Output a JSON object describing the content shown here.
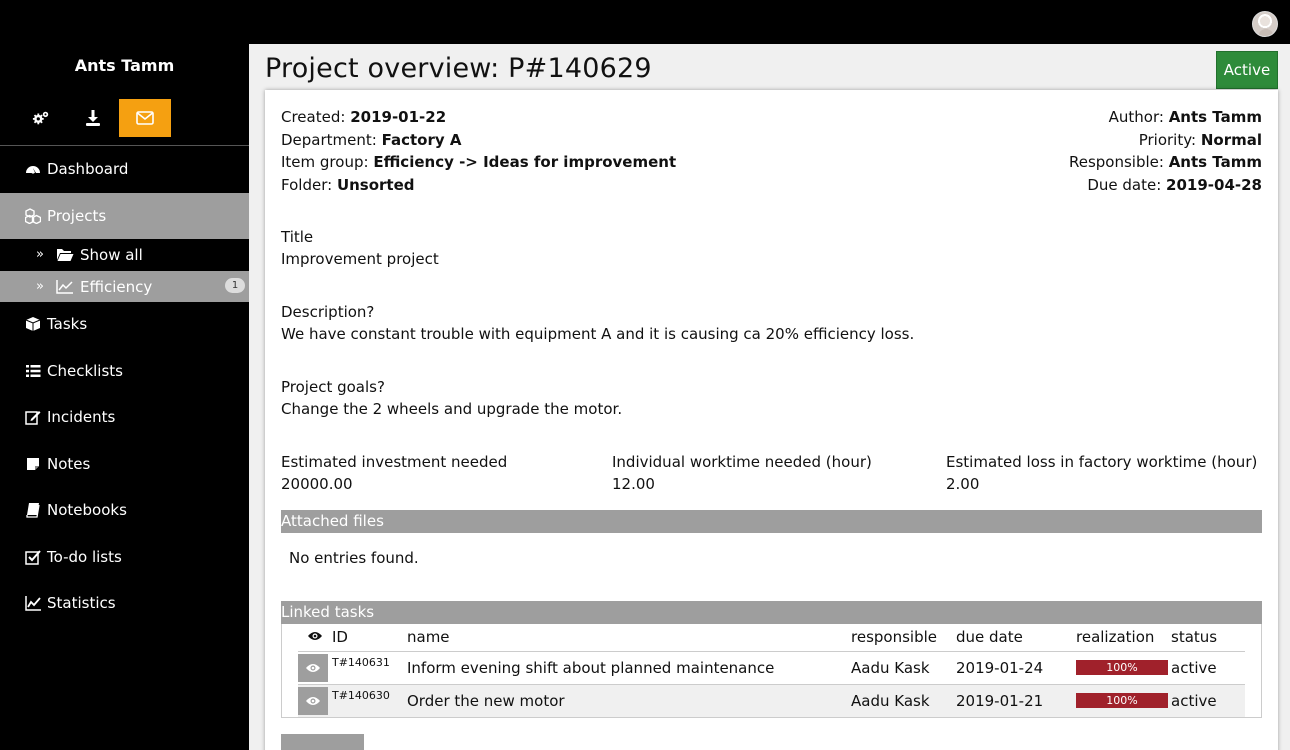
{
  "sidebar": {
    "username": "Ants Tamm",
    "tools": [
      {
        "icon": "gears-icon"
      },
      {
        "icon": "download-icon"
      },
      {
        "icon": "envelope-icon",
        "active": true
      }
    ],
    "nav": [
      {
        "label": "Dashboard",
        "icon": "dashboard-icon"
      },
      {
        "label": "Projects",
        "icon": "cubes-icon",
        "active": true
      },
      {
        "label": "Tasks",
        "icon": "cube-icon"
      },
      {
        "label": "Checklists",
        "icon": "list-icon"
      },
      {
        "label": "Incidents",
        "icon": "edit-icon"
      },
      {
        "label": "Notes",
        "icon": "sticky-note-icon"
      },
      {
        "label": "Notebooks",
        "icon": "book-icon"
      },
      {
        "label": "To-do lists",
        "icon": "check-square-icon"
      },
      {
        "label": "Statistics",
        "icon": "line-chart-icon"
      }
    ],
    "sub_items": [
      {
        "label": "Show all",
        "icon": "folder-open-icon"
      },
      {
        "label": "Efficiency",
        "icon": "area-chart-icon",
        "badge": "1",
        "active": true
      }
    ]
  },
  "page": {
    "title": "Project overview: P#140629",
    "status": "Active",
    "status_color": "#2e8b3a"
  },
  "meta": {
    "created_label": "Created:",
    "created": "2019-01-22",
    "department_label": "Department:",
    "department": "Factory A",
    "item_group_label": "Item group:",
    "item_group": "Efficiency -> Ideas for improvement",
    "folder_label": "Folder:",
    "folder": "Unsorted",
    "author_label": "Author:",
    "author": "Ants Tamm",
    "priority_label": "Priority:",
    "priority": "Normal",
    "responsible_label": "Responsible:",
    "responsible": "Ants Tamm",
    "due_label": "Due date:",
    "due": "2019-04-28"
  },
  "fields": {
    "title_label": "Title",
    "title_value": "Improvement project",
    "description_label": "Description?",
    "description_value": "We have constant trouble with equipment A and it is causing ca 20% efficiency loss.",
    "goals_label": "Project goals?",
    "goals_value": "Change the 2 wheels and upgrade the motor."
  },
  "estimates": [
    {
      "label": "Estimated investment needed",
      "value": "20000.00"
    },
    {
      "label": "Individual worktime needed (hour)",
      "value": "12.00"
    },
    {
      "label": "Estimated loss in factory worktime (hour)",
      "value": "2.00"
    }
  ],
  "files": {
    "heading": "Attached files",
    "empty_text": "No entries found."
  },
  "tasks": {
    "heading": "Linked tasks",
    "columns": {
      "id": "ID",
      "name": "name",
      "responsible": "responsible",
      "due": "due date",
      "realization": "realization",
      "status": "status"
    },
    "rows": [
      {
        "id": "T#140631",
        "name": "Inform evening shift about planned maintenance",
        "responsible": "Aadu Kask",
        "due": "2019-01-24",
        "realization": "100%",
        "realization_fraction": 1.0,
        "status": "active"
      },
      {
        "id": "T#140630",
        "name": "Order the new motor",
        "responsible": "Aadu Kask",
        "due": "2019-01-21",
        "realization": "100%",
        "realization_fraction": 1.0,
        "status": "active"
      }
    ]
  },
  "colors": {
    "accent": "#f5a011",
    "sidebar_active": "#9e9e9e",
    "progress": "#a0212b"
  }
}
